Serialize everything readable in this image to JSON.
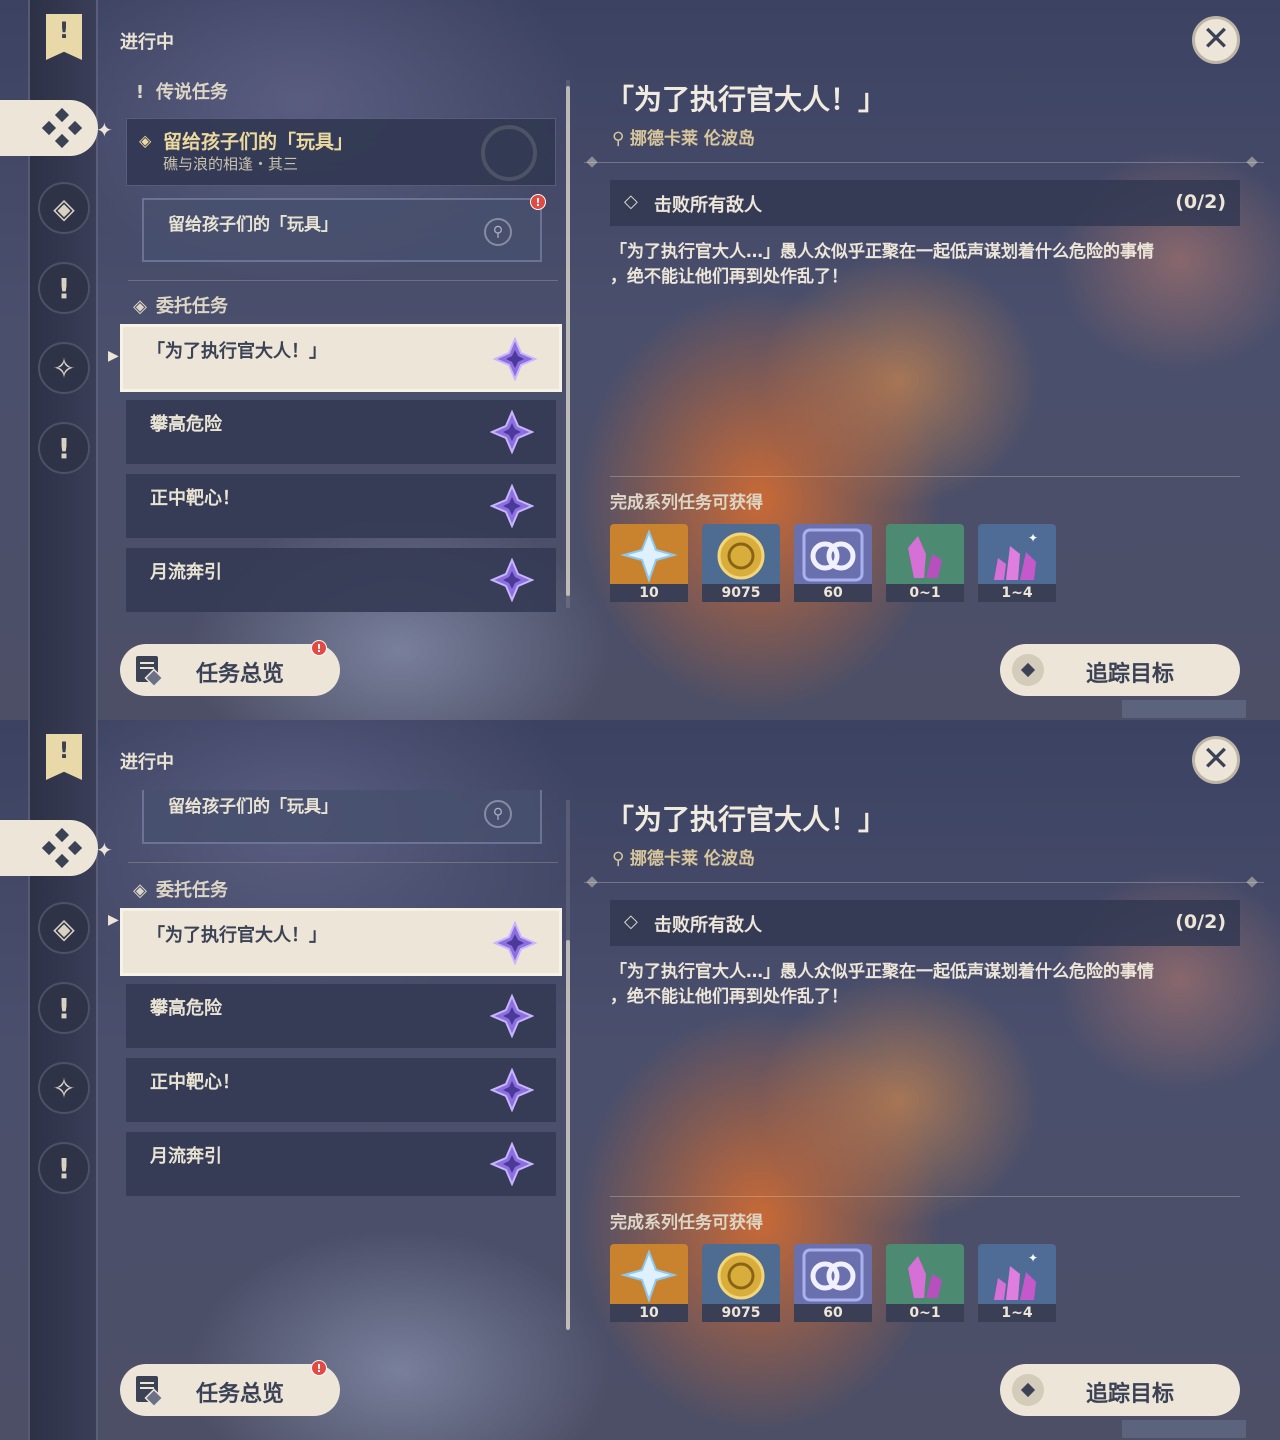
{
  "colors": {
    "accent_cream": "#ece5d8",
    "dark_navy": "#3b4255",
    "gold": "#ecd9a0",
    "badge_red": "#e24a44",
    "star_purple": "#8e6fe0"
  },
  "panels": [
    {
      "status_title": "进行中",
      "legend": {
        "category": "传说任务",
        "quest_title": "留给孩子们的「玩具」",
        "quest_subtitle": "礁与浪的相逢・其三",
        "subquest": "留给孩子们的「玩具」"
      },
      "commission": {
        "category": "委托任务"
      },
      "quests": [
        {
          "title": "「为了执行官大人！」",
          "selected": true
        },
        {
          "title": "攀高危险"
        },
        {
          "title": "正中靶心！"
        },
        {
          "title": "月流奔引"
        }
      ],
      "overview_button": "任务总览",
      "detail": {
        "title": "「为了执行官大人！」",
        "location": "挪德卡莱 伦波岛",
        "objective": "击败所有敌人",
        "objective_count": "(0/2)",
        "description_line1": "「为了执行官大人…」愚人众似乎正聚在一起低声谋划着什么危险的事情",
        "description_line2": "，绝不能让他们再到处作乱了！",
        "rewards_label": "完成系列任务可获得",
        "rewards": [
          {
            "icon": "primogem-icon",
            "count": "10"
          },
          {
            "icon": "mora-icon",
            "count": "9075"
          },
          {
            "icon": "companionship-exp-icon",
            "count": "60"
          },
          {
            "icon": "crystal-chunk-icon",
            "count": "0~1"
          },
          {
            "icon": "crystal-cluster-icon",
            "count": "1~4"
          }
        ]
      },
      "track_button": "追踪目标"
    },
    {
      "status_title": "进行中",
      "legend": {
        "subquest": "留给孩子们的「玩具」"
      },
      "commission": {
        "category": "委托任务"
      },
      "quests": [
        {
          "title": "「为了执行官大人！」",
          "selected": true
        },
        {
          "title": "攀高危险"
        },
        {
          "title": "正中靶心！"
        },
        {
          "title": "月流奔引"
        }
      ],
      "overview_button": "任务总览",
      "detail": {
        "title": "「为了执行官大人！」",
        "location": "挪德卡莱 伦波岛",
        "objective": "击败所有敌人",
        "objective_count": "(0/2)",
        "description_line1": "「为了执行官大人…」愚人众似乎正聚在一起低声谋划着什么危险的事情",
        "description_line2": "，绝不能让他们再到处作乱了！",
        "rewards_label": "完成系列任务可获得",
        "rewards": [
          {
            "icon": "primogem-icon",
            "count": "10"
          },
          {
            "icon": "mora-icon",
            "count": "9075"
          },
          {
            "icon": "companionship-exp-icon",
            "count": "60"
          },
          {
            "icon": "crystal-chunk-icon",
            "count": "0~1"
          },
          {
            "icon": "crystal-cluster-icon",
            "count": "1~4"
          }
        ]
      },
      "track_button": "追踪目标"
    }
  ]
}
